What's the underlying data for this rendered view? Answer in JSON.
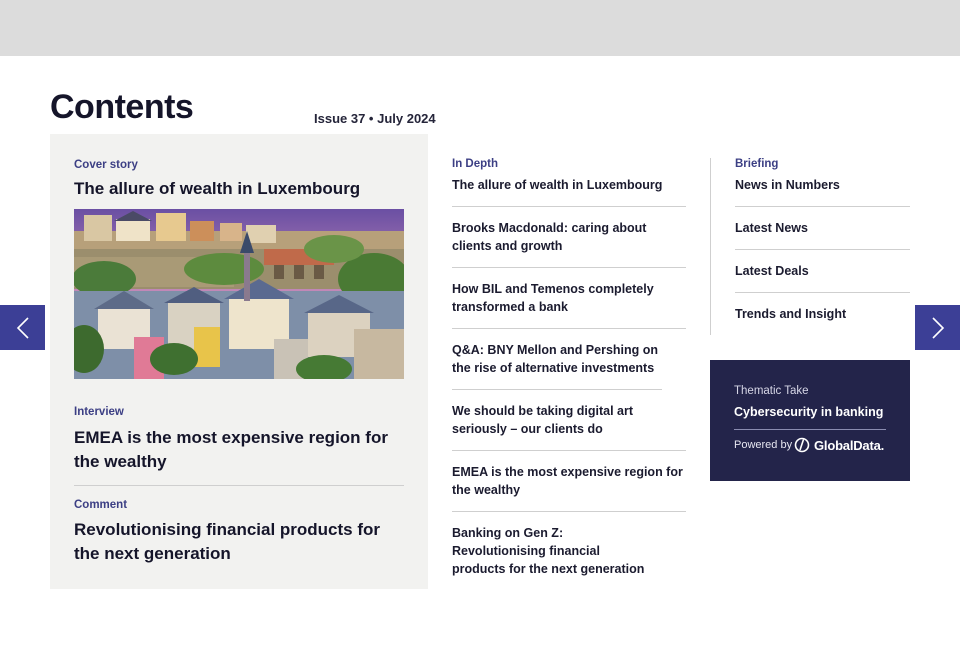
{
  "header": {
    "title": "Contents",
    "issue": "Issue 37 • July 2024"
  },
  "feature": {
    "cover": {
      "kicker": "Cover story",
      "title": "The allure of wealth in Luxembourg"
    },
    "interview": {
      "kicker": "Interview",
      "title": "EMEA is the most expensive region for the wealthy"
    },
    "comment": {
      "kicker": "Comment",
      "title": "Revolutionising financial products for the next generation"
    }
  },
  "in_depth": {
    "kicker": "In Depth",
    "items": [
      "The allure of wealth in Luxembourg",
      "Brooks Macdonald: caring about clients and growth",
      "How BIL and Temenos completely transformed a bank",
      "Q&A: BNY Mellon and Pershing on the rise of alternative investments",
      "We should be taking digital art seriously – our clients do",
      "EMEA is the most expensive region for the wealthy",
      "Banking on Gen Z: Revolutionising financial products for the next generation"
    ]
  },
  "briefing": {
    "kicker": "Briefing",
    "items": [
      "News in Numbers",
      "Latest News",
      "Latest Deals",
      "Trends and Insight"
    ]
  },
  "thematic": {
    "label": "Thematic Take",
    "title": "Cybersecurity in banking",
    "powered_by": "Powered by",
    "logo_text": "GlobalData."
  },
  "nav": {
    "prev_icon": "chevron-left-icon",
    "next_icon": "chevron-right-icon"
  },
  "colors": {
    "accent": "#3c3f96",
    "kicker": "#3c3f84",
    "thematic_bg": "#23244a",
    "panel_bg": "#f2f2f0",
    "topbar": "#dcdcdc"
  }
}
